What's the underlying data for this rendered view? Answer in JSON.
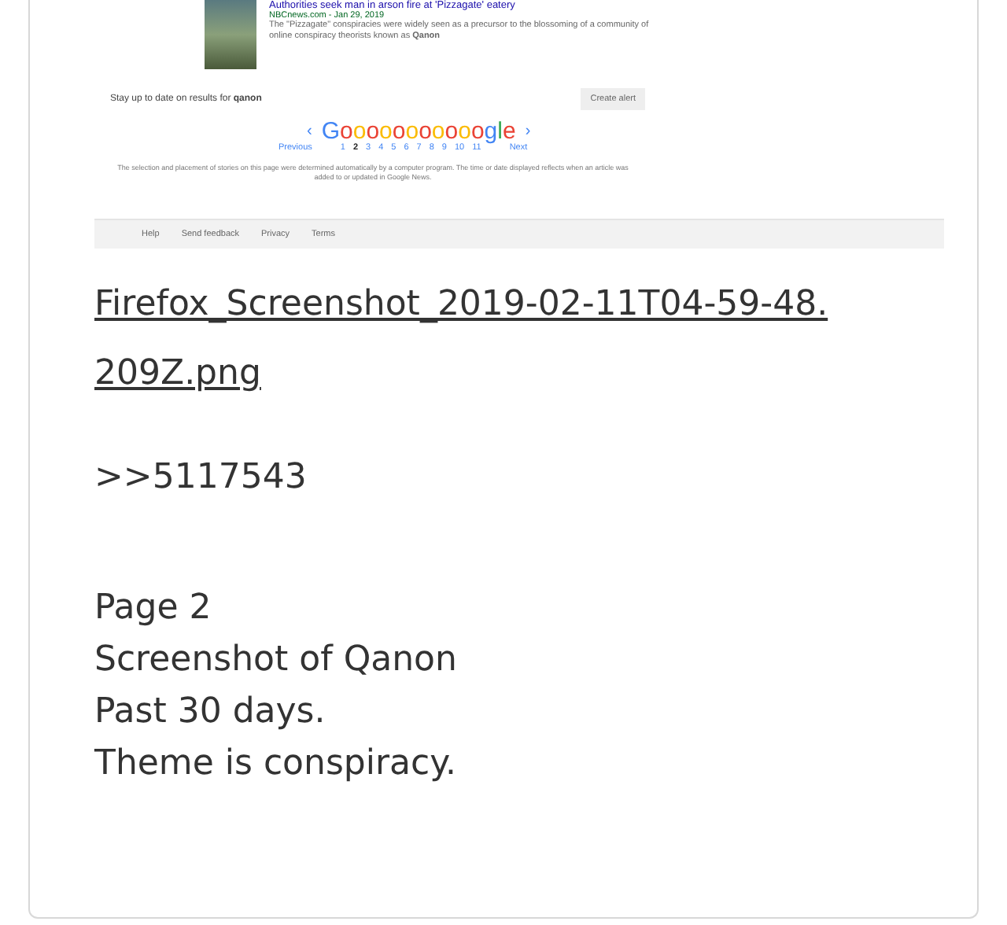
{
  "screenshot": {
    "article": {
      "title": "Authorities seek man in arson fire at 'Pizzagate' eatery",
      "source": "NBCnews.com - Jan 29, 2019",
      "snippet": "The \"Pizzagate\" conspiracies were widely seen as a precursor to the blossoming of a community of online conspiracy theorists known as **Qanon**"
    },
    "alert_text": "Stay up to date on results for **qanon**",
    "alert_button": "Create alert",
    "pager": {
      "prev_arrow": "‹",
      "logo": "Gooooooooooogle",
      "next_arrow": "›",
      "previous": "Previous",
      "next": "Next",
      "pages": [
        {
          "label": "1",
          "selected": false
        },
        {
          "label": "2",
          "selected": true
        },
        {
          "label": "3",
          "selected": false
        },
        {
          "label": "4",
          "selected": false
        },
        {
          "label": "5",
          "selected": false
        },
        {
          "label": "6",
          "selected": false
        },
        {
          "label": "7",
          "selected": false
        },
        {
          "label": "8",
          "selected": false
        },
        {
          "label": "9",
          "selected": false
        },
        {
          "label": "10",
          "selected": false
        },
        {
          "label": "11",
          "selected": false
        }
      ]
    },
    "disclaimer": "The selection and placement of stories on this page were determined automatically by a computer program. The time or date displayed reflects when an article was added to or updated in Google News.",
    "footer": [
      "Help",
      "Send feedback",
      "Privacy",
      "Terms"
    ]
  },
  "file_link": "Firefox_Screenshot_2019-02-11T04-59-48.209Z.png",
  "post_ref": ">>5117543",
  "lines": [
    "Page 2",
    "Screenshot of Qanon",
    "Past 30 days.",
    "Theme is conspiracy."
  ]
}
